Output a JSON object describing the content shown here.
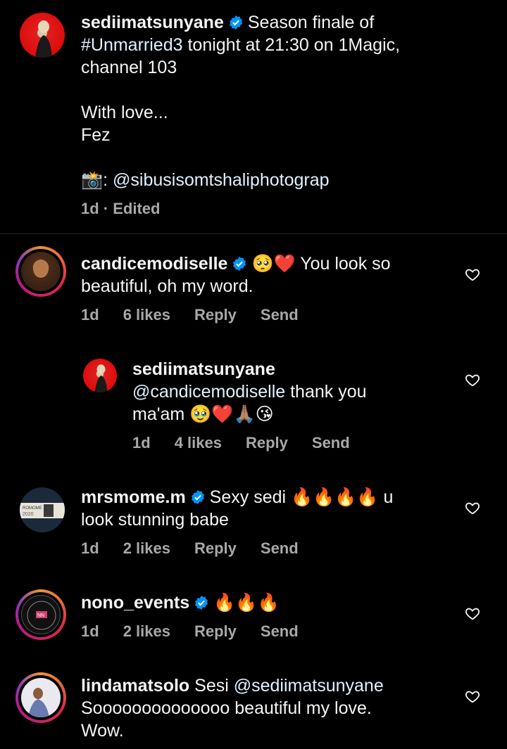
{
  "caption": {
    "username": "sediimatsunyane",
    "line1": "Season finale of",
    "hashtag": "#Unmarried3",
    "line2_rest": "tonight at 21:30 on 1Magic,",
    "line3": "channel 103",
    "line4": "With love...",
    "line5": "Fez",
    "camera_emoji": "📸",
    "credit": ": @sibusisomtshaliphotograp",
    "meta": "1d · Edited"
  },
  "comments": [
    {
      "username": "candicemodiselle",
      "emoji": "🥺❤️",
      "text_line1": "You look so",
      "text_line2": "beautiful, oh my word.",
      "time": "1d",
      "likes": "6 likes",
      "reply": "Reply",
      "send": "Send"
    },
    {
      "username": "sediimatsunyane",
      "mention": "@candicemodiselle",
      "text_line1": "thank you",
      "text_line2": "ma'am",
      "emoji": "🥹❤️🙏🏽😘",
      "time": "1d",
      "likes": "4 likes",
      "reply": "Reply",
      "send": "Send"
    },
    {
      "username": "mrsmome.m",
      "text_line1": "Sexy sedi",
      "emoji": "🔥🔥🔥🔥",
      "text_line1_end": "u",
      "text_line2": "look stunning babe",
      "time": "1d",
      "likes": "2 likes",
      "reply": "Reply",
      "send": "Send"
    },
    {
      "username": "nono_events",
      "emoji": "🔥🔥🔥",
      "time": "1d",
      "likes": "2 likes",
      "reply": "Reply",
      "send": "Send"
    },
    {
      "username": "lindamatsolo",
      "text_line1_pre": "Sesi",
      "mention": "@sediimatsunyane",
      "text_line2": "Soooooooooooooo beautiful my love.",
      "text_line3": "Wow."
    }
  ],
  "colors": {
    "background": "#000000",
    "text": "#f5f5f5",
    "meta": "#a8a8a8",
    "verified": "#0095f6",
    "mention": "#e0f1ff"
  },
  "icons": [
    "verified-badge-icon",
    "heart-outline-icon",
    "camera-flash-icon"
  ]
}
